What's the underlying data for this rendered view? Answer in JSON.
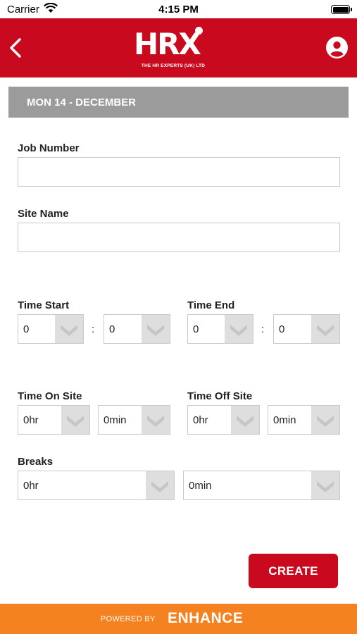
{
  "status_bar": {
    "carrier": "Carrier",
    "time": "4:15 PM"
  },
  "header": {
    "logo_text": "HRX",
    "logo_subtitle": "THE HR EXPERTS (UK) LTD",
    "icons": {
      "back": "chevron-left-icon",
      "profile": "user-circle-icon"
    },
    "color": "#c8091e"
  },
  "date_bar": {
    "label": "MON 14 - DECEMBER"
  },
  "form": {
    "job_number": {
      "label": "Job Number",
      "value": ""
    },
    "site_name": {
      "label": "Site Name",
      "value": ""
    },
    "time_start": {
      "label": "Time Start",
      "hours": "0",
      "minutes": "0",
      "separator": ":"
    },
    "time_end": {
      "label": "Time End",
      "hours": "0",
      "minutes": "0",
      "separator": ":"
    },
    "time_on_site": {
      "label": "Time On Site",
      "hours": "0hr",
      "minutes": "0min"
    },
    "time_off_site": {
      "label": "Time Off Site",
      "hours": "0hr",
      "minutes": "0min"
    },
    "breaks": {
      "label": "Breaks",
      "hours": "0hr",
      "minutes": "0min"
    }
  },
  "actions": {
    "create_label": "CREATE"
  },
  "footer": {
    "powered_by": "POWERED BY",
    "brand": "ENHANCE",
    "color": "#f58220"
  }
}
